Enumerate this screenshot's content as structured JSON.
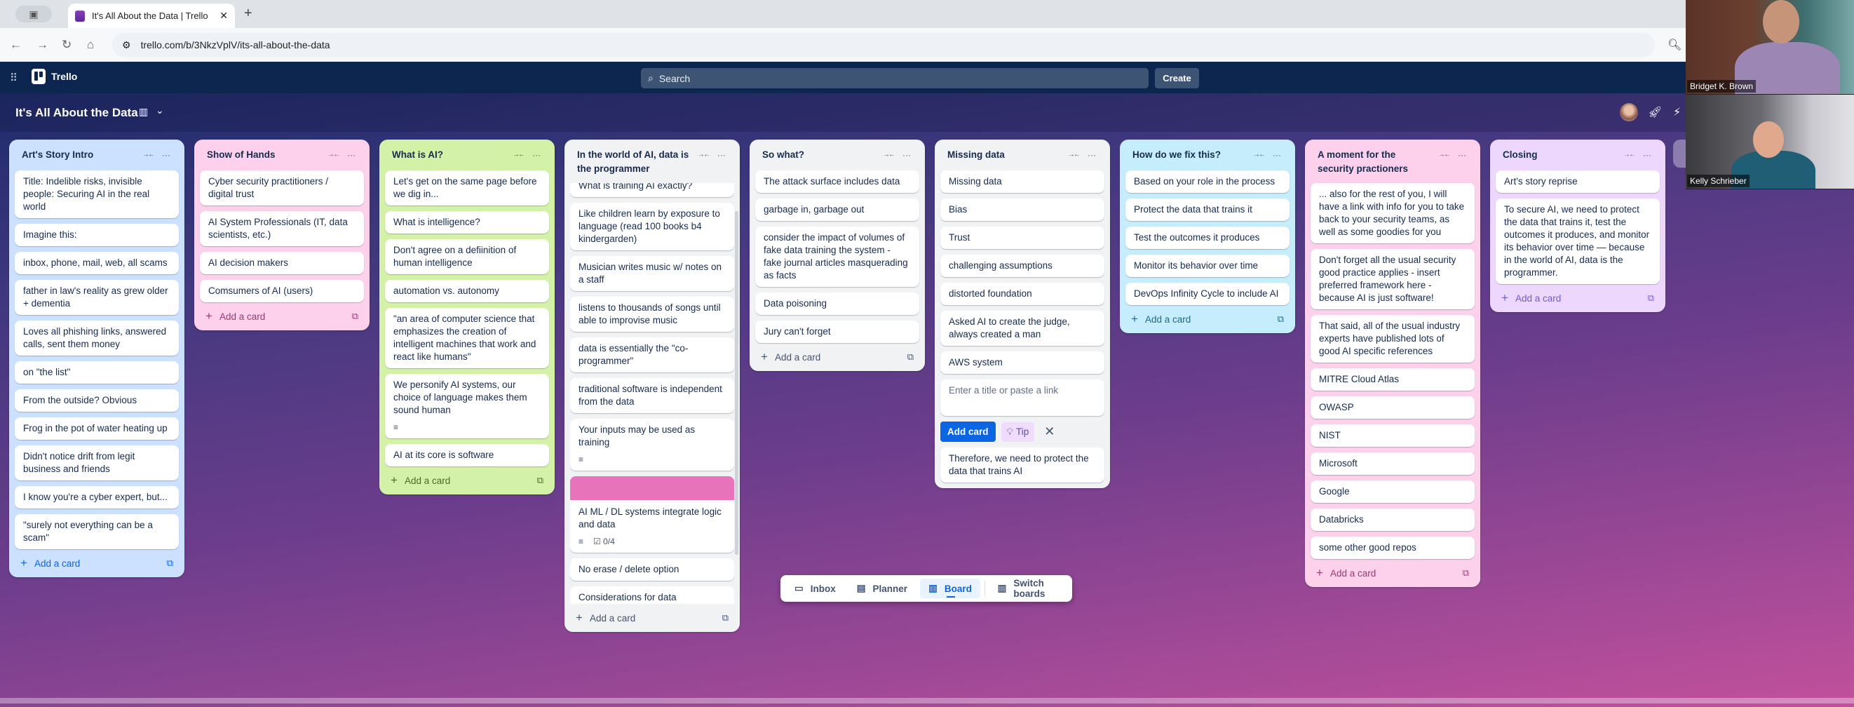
{
  "browser": {
    "tab_title": "It's All About the Data | Trello",
    "url": "trello.com/b/3NkzVplV/its-all-about-the-data"
  },
  "header": {
    "app_name": "Trello",
    "search_placeholder": "Search",
    "create_label": "Create"
  },
  "board": {
    "title": "It's All About the Data",
    "add_card_label": "Add a card"
  },
  "lists": [
    {
      "title": "Art's Story Intro",
      "color": "#cce0ff",
      "text_color": "#0c66e4",
      "cards": [
        {
          "text": "Title: Indelible risks, invisible people: Securing AI in the real world"
        },
        {
          "text": "Imagine this:"
        },
        {
          "text": "inbox, phone, mail, web, all scams"
        },
        {
          "text": "father in law's reality as grew older + dementia"
        },
        {
          "text": "Loves all phishing links, answered calls, sent them money"
        },
        {
          "text": "on \"the list\""
        },
        {
          "text": "From the outside? Obvious"
        },
        {
          "text": "Frog in the pot of water heating up"
        },
        {
          "text": "Didn't notice drift from legit business and friends"
        },
        {
          "text": "I know you're a cyber expert, but..."
        },
        {
          "text": "\"surely not everything can be a scam\""
        }
      ]
    },
    {
      "title": "Show of Hands",
      "color": "#fdd0ec",
      "text_color": "#943d73",
      "cards": [
        {
          "text": "Cyber security practitioners / digital trust"
        },
        {
          "text": "AI System Professionals (IT, data scientists, etc.)"
        },
        {
          "text": "AI decision makers"
        },
        {
          "text": "Comsumers of AI (users)"
        }
      ]
    },
    {
      "title": "What is AI?",
      "color": "#d3f1a7",
      "text_color": "#4c6b1f",
      "cards": [
        {
          "text": "Let's get on the same page before we dig in..."
        },
        {
          "text": "What is intelligence?"
        },
        {
          "text": "Don't agree on a defiinition of human intelligence"
        },
        {
          "text": "automation vs. autonomy"
        },
        {
          "text": "\"an area of computer science that emphasizes the creation of intelligent machines that work and react like humans\""
        },
        {
          "text": "We personify AI systems, our choice of language makes them sound human",
          "has_description": true
        },
        {
          "text": "AI at its core is software"
        }
      ]
    },
    {
      "title": "In the world of AI, data is the programmer",
      "color": "#f1f2f4",
      "text_color": "#44546f",
      "scrolled": true,
      "cards": [
        {
          "text": "What is training AI exactly?"
        },
        {
          "text": "Like children learn by exposure to language (read 100 books b4 kindergarden)"
        },
        {
          "text": "Musician writes music w/ notes on a staff"
        },
        {
          "text": "listens to thousands of songs until able to improvise music"
        },
        {
          "text": "data is essentially the \"co-programmer\""
        },
        {
          "text": "traditional software is independent from the data"
        },
        {
          "text": "Your inputs may be used as training",
          "has_description": true
        },
        {
          "text": "AI ML / DL systems integrate logic and data",
          "cover": "#e774bb",
          "has_description": true,
          "checklist": "0/4"
        },
        {
          "text": "No erase / delete option"
        },
        {
          "text": "Considerations for data"
        }
      ]
    },
    {
      "title": "So what?",
      "color": "#f1f2f4",
      "text_color": "#44546f",
      "cards": [
        {
          "text": "The attack surface includes data"
        },
        {
          "text": "garbage in, garbage out"
        },
        {
          "text": "consider the impact of volumes of fake data training the system - fake journal articles masquerading as facts"
        },
        {
          "text": "Data poisoning"
        },
        {
          "text": "Jury can't forget"
        }
      ]
    },
    {
      "title": "Missing data",
      "color": "#f1f2f4",
      "text_color": "#44546f",
      "cards": [
        {
          "text": "Missing data"
        },
        {
          "text": "Bias"
        },
        {
          "text": "Trust"
        },
        {
          "text": "challenging assumptions"
        },
        {
          "text": "distorted foundation"
        },
        {
          "text": "Asked AI to create the judge, always created a man"
        },
        {
          "text": "AWS system"
        }
      ],
      "composer": {
        "placeholder": "Enter a title or paste a link",
        "add_label": "Add card",
        "tip_label": "Tip"
      },
      "cards_after_composer": [
        {
          "text": "Therefore, we need to protect the data that trains AI"
        }
      ]
    },
    {
      "title": "How do we fix this?",
      "color": "#c6edfb",
      "text_color": "#206a83",
      "cards": [
        {
          "text": "Based on your role in the process"
        },
        {
          "text": "Protect the data that trains it"
        },
        {
          "text": "Test the outcomes it produces"
        },
        {
          "text": "Monitor its behavior over time"
        },
        {
          "text": "DevOps Infinity Cycle to include AI"
        }
      ]
    },
    {
      "title": "A moment for the security practioners",
      "color": "#fdd0ec",
      "text_color": "#943d73",
      "cards": [
        {
          "text": "... also for the rest of you, I will have a link with info for you to take back to your security teams, as well as some goodies for you"
        },
        {
          "text": "Don't forget all the usual security good practice applies - insert preferred framework here - because AI is just software!"
        },
        {
          "text": "That said, all of the usual industry experts have published lots of good AI specific references"
        },
        {
          "text": "MITRE Cloud Atlas"
        },
        {
          "text": "OWASP"
        },
        {
          "text": "NIST"
        },
        {
          "text": "Microsoft"
        },
        {
          "text": "Google"
        },
        {
          "text": "Databricks"
        },
        {
          "text": "some other good repos"
        }
      ]
    },
    {
      "title": "Closing",
      "color": "#eed7fc",
      "text_color": "#6e5dc6",
      "cards": [
        {
          "text": "Art's story reprise"
        },
        {
          "text": "To secure AI, we need to protect the data that trains it, test the outcomes it produces, and monitor its behavior over time — because in the world of AI, data is the programmer."
        }
      ]
    }
  ],
  "dock": {
    "items": [
      {
        "label": "Inbox",
        "icon": "inbox-icon"
      },
      {
        "label": "Planner",
        "icon": "calendar-icon"
      },
      {
        "label": "Board",
        "icon": "board-icon",
        "active": true
      }
    ],
    "switch_label": "Switch boards"
  },
  "video_call": {
    "participants": [
      {
        "name": "Bridget K. Brown"
      },
      {
        "name": "Kelly Schrieber"
      }
    ]
  }
}
